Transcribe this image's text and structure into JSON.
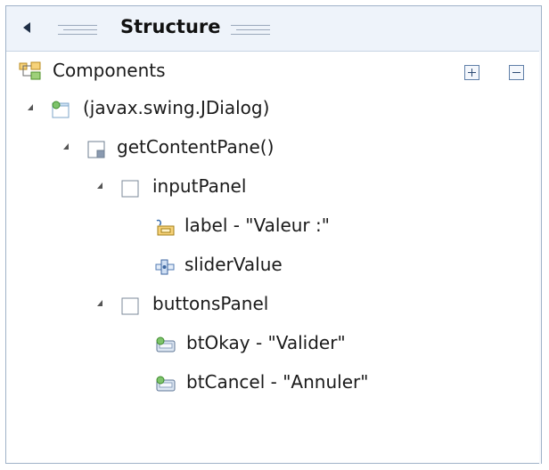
{
  "panel": {
    "title": "Structure",
    "section_label": "Components",
    "expand_all_label": "Expand all",
    "collapse_all_label": "Collapse all"
  },
  "tree": [
    {
      "label": "(javax.swing.JDialog)",
      "icon": "dialog-icon"
    },
    {
      "label": "getContentPane()",
      "icon": "content-pane-icon"
    },
    {
      "label": "inputPanel",
      "icon": "panel-icon"
    },
    {
      "label": "label - \"Valeur :\"",
      "icon": "label-icon"
    },
    {
      "label": "sliderValue",
      "icon": "slider-icon"
    },
    {
      "label": "buttonsPanel",
      "icon": "panel-icon"
    },
    {
      "label": "btOkay - \"Valider\"",
      "icon": "button-icon"
    },
    {
      "label": "btCancel - \"Annuler\"",
      "icon": "button-icon"
    }
  ],
  "colors": {
    "title_bar": "#eef3fa",
    "border": "#9fb2c8",
    "accent": "#2c4a74"
  }
}
